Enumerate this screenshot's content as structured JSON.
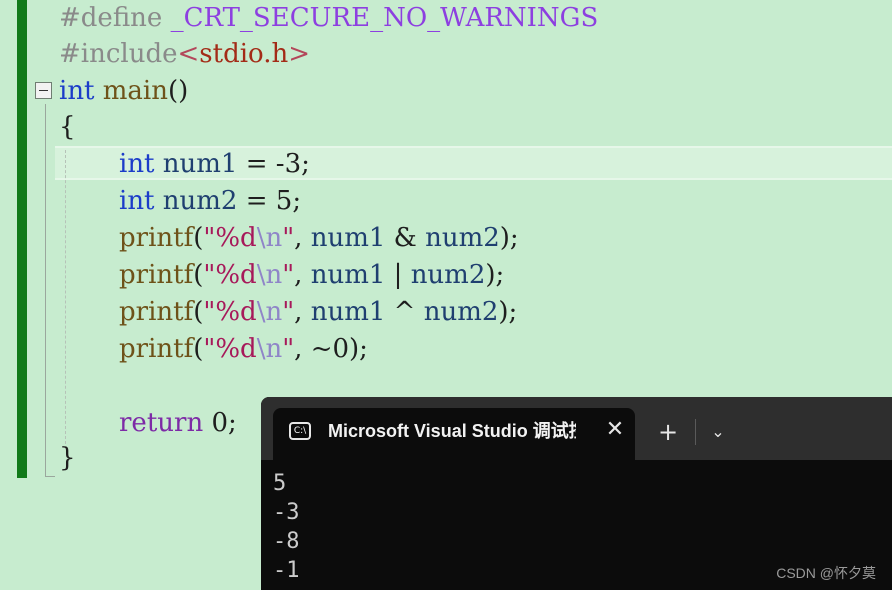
{
  "editor": {
    "lines": [
      {
        "pre": "#define ",
        "macro": "_CRT_SECURE_NO_WARNINGS"
      },
      {
        "pre": "#include",
        "open": "<",
        "header": "stdio.h",
        "close": ">"
      },
      {
        "type": "int",
        "name": "main",
        "parens": "()"
      },
      {
        "text": "{"
      },
      {
        "type": "int",
        "var": "num1",
        "rest": " = -3;"
      },
      {
        "type": "int",
        "var": "num2",
        "rest": " = 5;"
      },
      {
        "fn": "printf",
        "p1": "(",
        "q1": "\"%d",
        "esc": "\\n",
        "q2": "\"",
        "sep": ", ",
        "a": "num1",
        "op": " & ",
        "b": "num2",
        "end": ");"
      },
      {
        "fn": "printf",
        "p1": "(",
        "q1": "\"%d",
        "esc": "\\n",
        "q2": "\"",
        "sep": ", ",
        "a": "num1",
        "op": " | ",
        "b": "num2",
        "end": ");"
      },
      {
        "fn": "printf",
        "p1": "(",
        "q1": "\"%d",
        "esc": "\\n",
        "q2": "\"",
        "sep": ", ",
        "a": "num1",
        "op": " ^ ",
        "b": "num2",
        "end": ");"
      },
      {
        "fn": "printf",
        "p1": "(",
        "q1": "\"%d",
        "esc": "\\n",
        "q2": "\"",
        "sep": ", ",
        "arg": "~0",
        "end": ");"
      },
      {
        "kw": "return",
        "rest": " 0;"
      },
      {
        "text": "}"
      }
    ]
  },
  "terminal": {
    "tab_title": "Microsoft Visual Studio 调试控制台",
    "tab_icon_text": "C:\\",
    "close_glyph": "✕",
    "new_tab_glyph": "+",
    "dropdown_glyph": "⌄",
    "output": [
      "5",
      "-3",
      "-8",
      "-1"
    ]
  },
  "watermark": "CSDN @怀夕莫",
  "colors": {
    "editor_background": "#c7eccf",
    "change_bar": "#117a1a",
    "keyword": "#1b3cc9",
    "string": "#a7195a",
    "terminal_background": "#0c0c0c",
    "terminal_titlebar": "#2e2e2e"
  }
}
